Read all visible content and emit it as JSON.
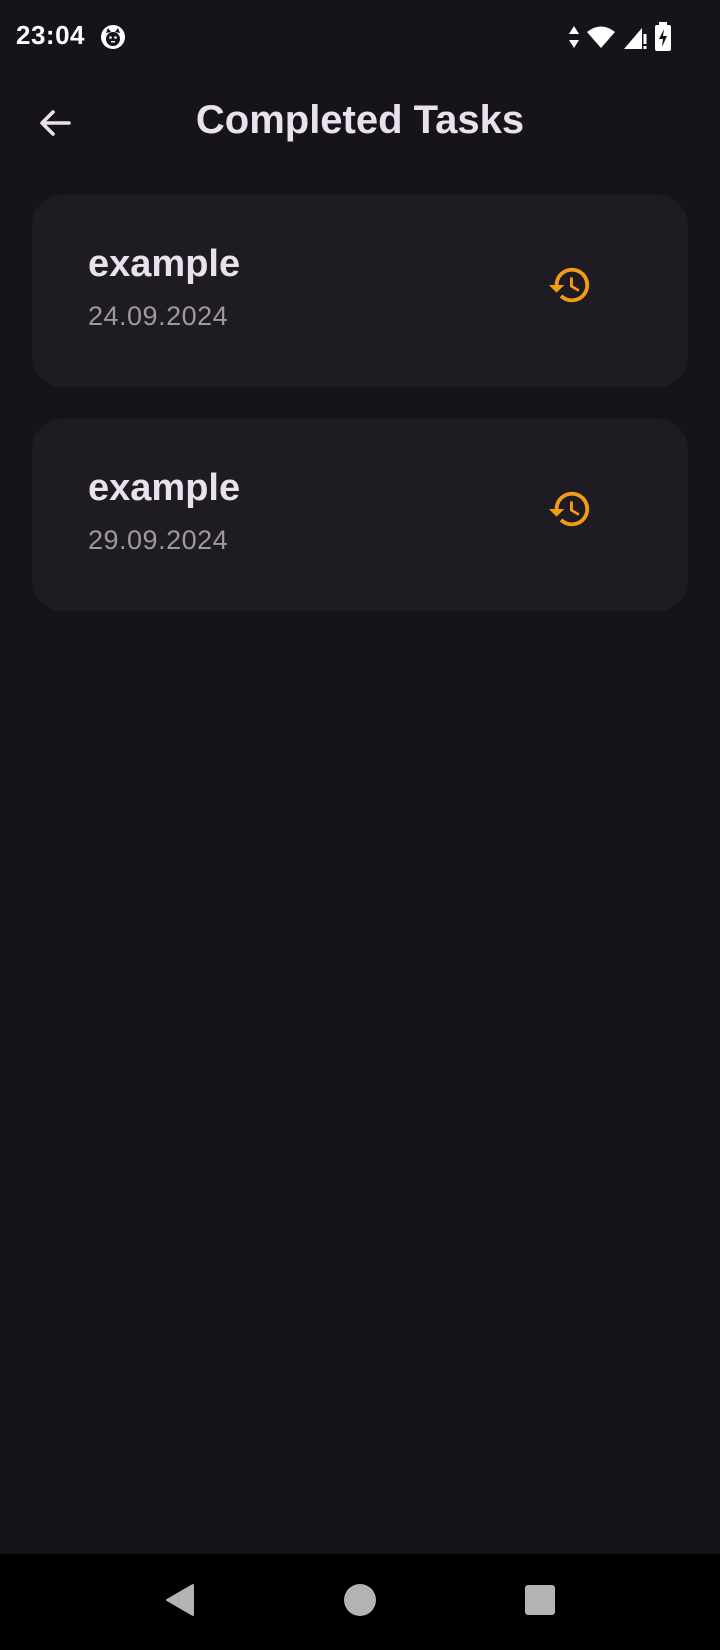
{
  "status_bar": {
    "time": "23:04",
    "app_icon": "cat-face-icon",
    "icons": [
      "data-arrows-icon",
      "wifi-icon",
      "cell-signal-icon",
      "battery-charging-icon"
    ]
  },
  "app_bar": {
    "title": "Completed Tasks",
    "back_icon": "arrow-left-icon"
  },
  "tasks": [
    {
      "title": "example",
      "date": "24.09.2024",
      "action_icon": "restore-history-icon"
    },
    {
      "title": "example",
      "date": "29.09.2024",
      "action_icon": "restore-history-icon"
    }
  ],
  "nav_bar": {
    "buttons": [
      "back-triangle-icon",
      "home-circle-icon",
      "recents-square-icon"
    ]
  },
  "colors": {
    "background": "#16131a",
    "card": "#1e1b22",
    "accent": "#f39c1a",
    "title_text": "#e8e2ec",
    "secondary_text": "#9d98a3"
  }
}
